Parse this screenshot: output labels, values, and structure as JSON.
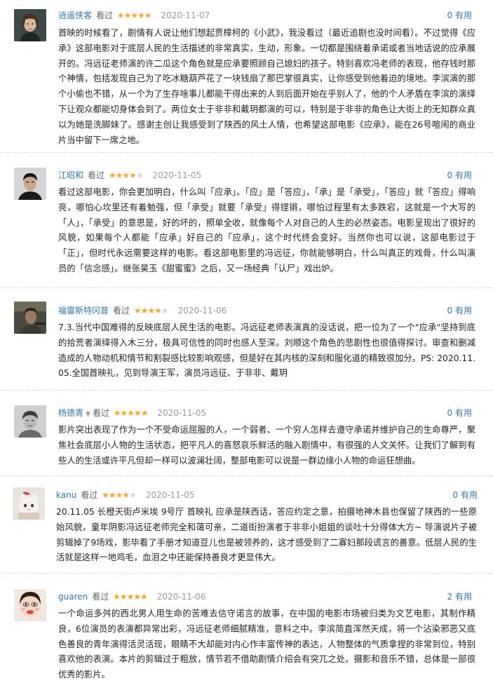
{
  "accent_color": "#3377aa",
  "star_color": "#f0a92a",
  "reviews": [
    {
      "author": "逍遥侠客",
      "watched": "看过",
      "rating": 5,
      "date": "2020-11-07",
      "useful": "0 有用",
      "avatar": "woman-portrait",
      "text": "首映的时候看了，剧情有人说让他们想起贾樟柯的《小武》，我没看过（最近追剧也没时间看）。不过觉得《应承》这部电影对于底层人民的生活描述的非常真实，生动，形象。一切都是围绕着承诺或者当地话说的应承展开的。冯远征老师演的许二瓜这个角色就是应承要照顾自己媳妇的孩子。特别喜欢冯老师的表现，他存钱时那个神情，包括发现自己为了吃冰糖葫芦花了一块钱扇了那巴掌很真实，让你感受到他着迫的境地。李滨演的那个小偷也不错，从一个为了生存啥事儿都能干得出来的人到后面开始在乎别人了，他的个人矛盾在李滨的演绎下让观众都能切身体会到了。两位女士于非非和戴玥都演的可以，特别是于非非的角色让大街上的无知群众真以为她是洗脚妹了。感谢主创让我感受到了陕西的风土人情，也希望这部电影《应承》，能在26号喧闹的商业片当中留下一席之地。"
    },
    {
      "author": "江昭和",
      "watched": "看过",
      "rating": 4,
      "date": "2020-11-05",
      "useful": "0 有用",
      "avatar": "man-portrait",
      "text": "看过这部电影，你会更加明白，什么叫「应承」。「应」是「答应」，「承」是「承受」，「答应」就「答应」得响亮，哪怕心坎里还有着勉强，但「承受」就要「承受」得铿锵，哪怕过程里有太多跌宕，这就是一个大写的「人」，「承受」的意思是，好的坏的，照单全收，就像每个人对自己的人生的必然姿态。电影呈现出了很好的风貌，如果每个人都能「应承」好自己的「应承」，这个时代终会变好。当然你也可以说，这部电影过于「正」，但时代永远需要这样的电影。看这部电影里的冯远征，你就能够明白，什么叫真正的戏骨，什么叫演员的「信念感」。继张昊玉《甜蜜蜜》之后，又一场经典「认尸」戏出炉。"
    },
    {
      "author": "福雷斯特冈普",
      "watched": "看过",
      "rating": 4,
      "date": "2020-11-06",
      "useful": "0 有用",
      "avatar": "movie-still",
      "text": "7.3.当代中国难得的反映底层人民生活的电影。冯远征老师表演真的没话说，把一位为了一个\"应承\"坚持到底的拾荒者演绎得入木三分，极具可信性的同时也感人至深。刘顺这个角色的悲剧性也很值得探讨。审查和删减造成的人物动机和情节和割裂感比较影响观感，但是好在其内核的深刻和服化道的精致很加分。PS: 2020.11.05.全国首映礼，见到导演王军，演员冯远征、于非非、戴玥"
    },
    {
      "author": "杨德青",
      "watched": "看过",
      "rating": 5,
      "date": "2020-11-05",
      "useful": "0 有用",
      "avatar": "sketch-portrait",
      "has_dropdown": true,
      "text": "影片突出表现了作为一个不受命运屈服的人，一个弱者、一个穷人怎样去遵守承诺并维护自己的生命尊严，聚焦社会底层小人物的生活状态，把平凡人的喜怒哀乐鲜活的融入剧情中，有很强的人文关怀。让我们了解到有些人的生活或许平凡但却一样可以波澜壮阔，整部电影可以说是一群边缘小人物的命运狂想曲。"
    },
    {
      "author": "kanu",
      "watched": "看过",
      "rating": 4,
      "date": "2020-11-05",
      "useful": "0 有用",
      "avatar": "cat-photo",
      "text": "20.11.05 长橙天街卢米埃 9号厅 首映礼 应承是陕西话，答应约定之意，拍摄地神木县也保留了陕西的一些原始风貌，童年阴影冯远征老师完全和蔼可亲，二道街扮演者于非非小姐姐的谈吐十分得体大方~ 导演说片子被剪辑掉了9场戏，影毕看了手册才知道豆儿也是被领养的，这才感受到了二寡妇那段谎言的善意。低层人民的生活就是这样一地鸡毛，血泪之中还能保持善良才更显伟大。"
    },
    {
      "author": "guaren",
      "watched": "看过",
      "rating": 5,
      "date": "2020-11-06",
      "useful": "2 有用",
      "avatar": "cartoon-face",
      "text": "一个命运多舛的西北男人用生命的苦难去信守诺言的故事，在中国的电影市场被归类为文艺电影，其制作精良，6位演员的表演都异常出彩，冯远征老师细腻精准，意料之中。李滨简直浑然天成，将一个沾染邪恶又底色善良的青年演得活灵活现，眼睛不大却能对内心作丰富传神的表达，人物整体的气质拿捏的非常到位，特别喜欢他的表演。本片的剪辑过于粗放，情节若不借助剧情介绍会有突兀之处。摄影和音乐不错，总体是一部很优秀的影片。"
    }
  ]
}
